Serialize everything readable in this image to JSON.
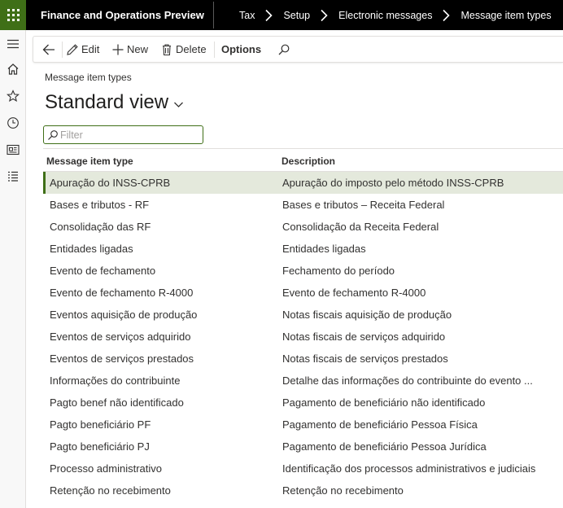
{
  "topbar": {
    "app_title": "Finance and Operations Preview",
    "breadcrumbs": [
      "Tax",
      "Setup",
      "Electronic messages",
      "Message item types"
    ]
  },
  "rail": {
    "items": [
      "hamburger-icon",
      "home-icon",
      "star-icon",
      "clock-icon",
      "workspace-icon",
      "list-icon"
    ]
  },
  "actions": {
    "edit_label": "Edit",
    "new_label": "New",
    "delete_label": "Delete",
    "options_label": "Options"
  },
  "page": {
    "caption": "Message item types",
    "view_name": "Standard view"
  },
  "filter": {
    "placeholder": "Filter",
    "value": ""
  },
  "grid": {
    "columns": [
      "Message item type",
      "Description"
    ],
    "selected_index": 0,
    "rows": [
      {
        "type": "Apuração do INSS-CPRB",
        "description": "Apuração do imposto pelo método INSS-CPRB"
      },
      {
        "type": "Bases e tributos - RF",
        "description": "Bases e tributos – Receita Federal"
      },
      {
        "type": "Consolidação das RF",
        "description": "Consolidação da Receita Federal"
      },
      {
        "type": "Entidades ligadas",
        "description": "Entidades ligadas"
      },
      {
        "type": "Evento de fechamento",
        "description": "Fechamento do período"
      },
      {
        "type": "Evento de fechamento R-4000",
        "description": "Evento de fechamento R-4000"
      },
      {
        "type": "Eventos aquisição de produção",
        "description": "Notas fiscais aquisição de produção"
      },
      {
        "type": "Eventos de serviços adquirido",
        "description": "Notas fiscais de serviços adquirido"
      },
      {
        "type": "Eventos de serviços prestados",
        "description": "Notas fiscais de serviços prestados"
      },
      {
        "type": "Informações do contribuinte",
        "description": "Detalhe das informações do contribuinte do evento ..."
      },
      {
        "type": "Pagto benef não identificado",
        "description": "Pagamento de beneficiário não identificado"
      },
      {
        "type": "Pagto beneficiário PF",
        "description": "Pagamento de beneficiário Pessoa Física"
      },
      {
        "type": "Pagto beneficiário PJ",
        "description": "Pagamento de beneficiário Pessoa Jurídica"
      },
      {
        "type": "Processo administrativo",
        "description": "Identificação dos processos administrativos e judiciais"
      },
      {
        "type": "Retenção no recebimento",
        "description": "Retenção no recebimento"
      }
    ]
  },
  "colors": {
    "accent": "#3f6f17",
    "topbar": "#000000",
    "selected_row": "#e4e9dc"
  }
}
